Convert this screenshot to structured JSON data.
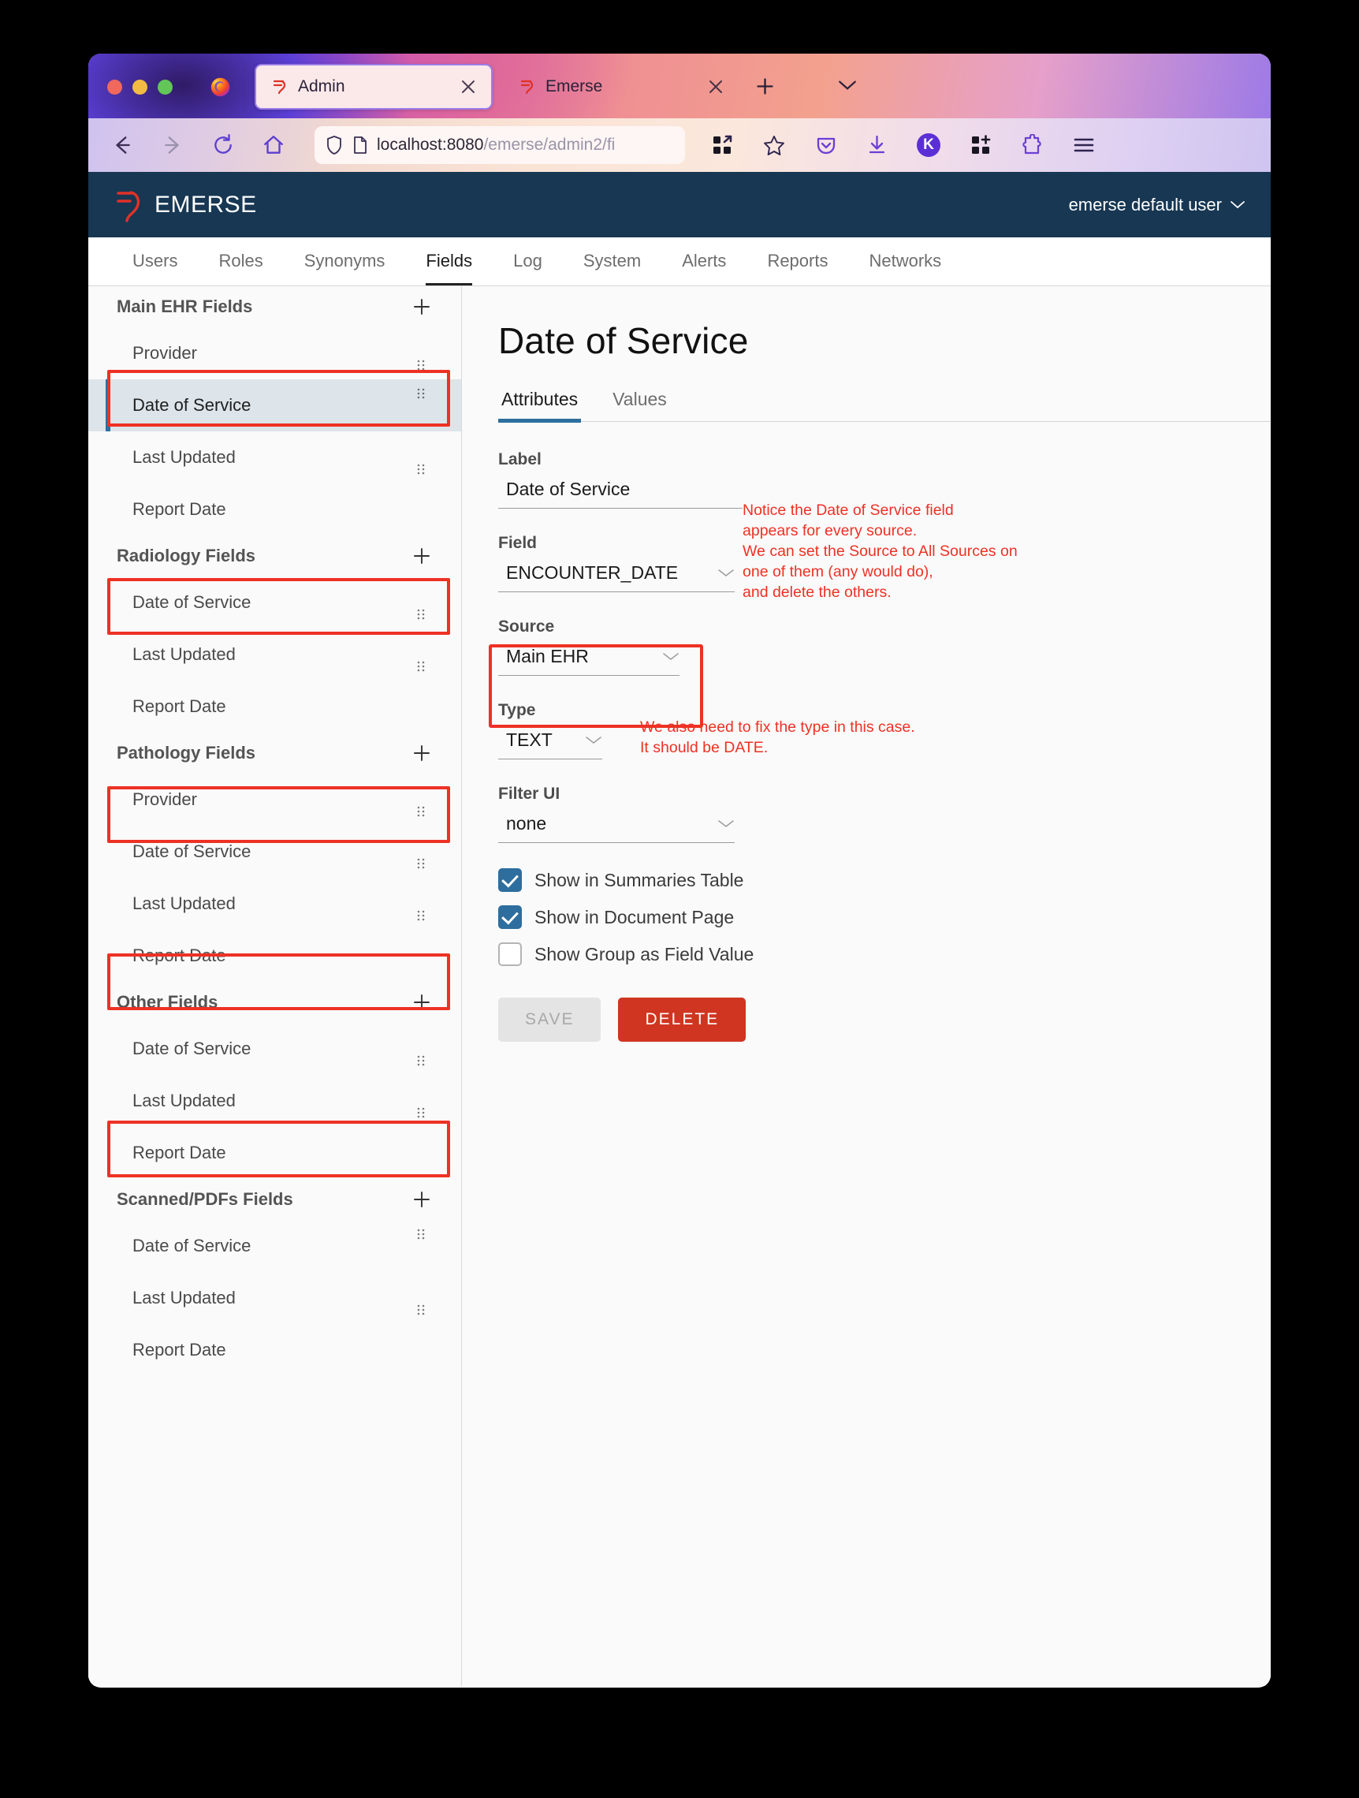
{
  "browser": {
    "tabs": [
      {
        "title": "Admin",
        "icon": "emerse-favicon",
        "active": true,
        "close_label": "✕"
      },
      {
        "title": "Emerse",
        "icon": "emerse-favicon",
        "active": false,
        "close_label": "✕"
      }
    ],
    "url": {
      "visible": "localhost:8080/emerse/admin2/fi",
      "solid": "localhost:8080",
      "dim": "/emerse/admin2/fi"
    },
    "nav_icons": [
      "back-icon",
      "forward-icon",
      "reload-icon",
      "home-icon"
    ],
    "url_icons": [
      "shield-icon",
      "page-icon"
    ],
    "toolbar_icons": [
      "firefox-view-icon",
      "bookmark-star-icon",
      "pocket-icon",
      "download-icon",
      "extensions-grid-icon",
      "extension-puzzle-icon",
      "app-menu-icon"
    ],
    "account_initial": "K"
  },
  "app": {
    "brand": "EMERSE",
    "user": "emerse default user",
    "user_chevron": "⌄",
    "tabs": [
      {
        "label": "Users",
        "active": false
      },
      {
        "label": "Roles",
        "active": false
      },
      {
        "label": "Synonyms",
        "active": false
      },
      {
        "label": "Fields",
        "active": true
      },
      {
        "label": "Log",
        "active": false
      },
      {
        "label": "System",
        "active": false
      },
      {
        "label": "Alerts",
        "active": false
      },
      {
        "label": "Reports",
        "active": false
      },
      {
        "label": "Networks",
        "active": false
      }
    ]
  },
  "sidebar": {
    "add_label": "+",
    "groups": [
      {
        "title": "Main EHR Fields",
        "items": [
          {
            "label": "Provider",
            "selected": false,
            "highlighted": false
          },
          {
            "label": "Date of Service",
            "selected": true,
            "highlighted": true
          },
          {
            "label": "Last Updated",
            "selected": false,
            "highlighted": false
          },
          {
            "label": "Report Date",
            "selected": false,
            "highlighted": false
          }
        ]
      },
      {
        "title": "Radiology Fields",
        "items": [
          {
            "label": "Date of Service",
            "selected": false,
            "highlighted": true
          },
          {
            "label": "Last Updated",
            "selected": false,
            "highlighted": false
          },
          {
            "label": "Report Date",
            "selected": false,
            "highlighted": false
          }
        ]
      },
      {
        "title": "Pathology Fields",
        "items": [
          {
            "label": "Provider",
            "selected": false,
            "highlighted": false
          },
          {
            "label": "Date of Service",
            "selected": false,
            "highlighted": true
          },
          {
            "label": "Last Updated",
            "selected": false,
            "highlighted": false
          },
          {
            "label": "Report Date",
            "selected": false,
            "highlighted": false
          }
        ]
      },
      {
        "title": "Other Fields",
        "items": [
          {
            "label": "Date of Service",
            "selected": false,
            "highlighted": true
          },
          {
            "label": "Last Updated",
            "selected": false,
            "highlighted": false
          },
          {
            "label": "Report Date",
            "selected": false,
            "highlighted": false
          }
        ]
      },
      {
        "title": "Scanned/PDFs Fields",
        "items": [
          {
            "label": "Date of Service",
            "selected": false,
            "highlighted": true
          },
          {
            "label": "Last Updated",
            "selected": false,
            "highlighted": false
          },
          {
            "label": "Report Date",
            "selected": false,
            "highlighted": false
          }
        ]
      }
    ]
  },
  "detail": {
    "title": "Date of Service",
    "tabs": [
      {
        "label": "Attributes",
        "active": true
      },
      {
        "label": "Values",
        "active": false
      }
    ],
    "fields": {
      "label_caption": "Label",
      "label_value": "Date of Service",
      "field_caption": "Field",
      "field_value": "ENCOUNTER_DATE",
      "source_caption": "Source",
      "source_value": "Main EHR",
      "type_caption": "Type",
      "type_value": "TEXT",
      "filterui_caption": "Filter UI",
      "filterui_value": "none"
    },
    "checkboxes": [
      {
        "label": "Show in Summaries Table",
        "checked": true
      },
      {
        "label": "Show in Document Page",
        "checked": true
      },
      {
        "label": "Show Group as Field Value",
        "checked": false
      }
    ],
    "buttons": {
      "save": "SAVE",
      "delete": "DELETE"
    }
  },
  "annotations": {
    "source_note": "Notice the Date of Service field\nappears for every source.\nWe can set the Source to All Sources on\none of them (any would do),\nand delete the others.",
    "type_note": "We also need to fix the type in this case.\nIt should be DATE."
  },
  "colors": {
    "annotation_red": "#ee3124",
    "header_navy": "#173753",
    "accent_blue": "#2d6e9e",
    "delete_red": "#cf3520",
    "selected_bg": "#dde4ea"
  }
}
